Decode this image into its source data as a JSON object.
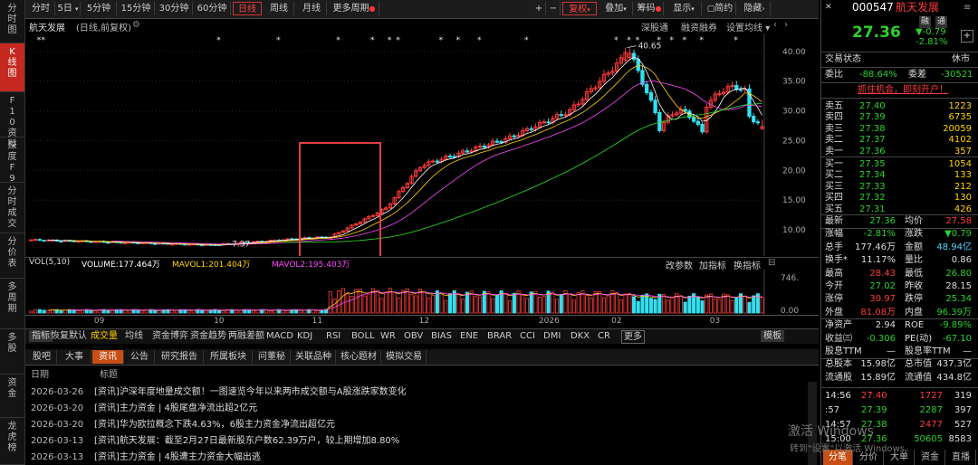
{
  "sidebar": [
    {
      "label": "分时图",
      "active": false
    },
    {
      "label": "K线图",
      "active": true
    },
    {
      "label": "F10资料",
      "active": false
    },
    {
      "label": "深度F9",
      "active": false
    },
    {
      "label": "分时成交",
      "active": false
    },
    {
      "label": "分价表",
      "active": false
    },
    {
      "label": "多周期",
      "active": false
    },
    {
      "label": "多股",
      "active": false
    },
    {
      "label": "资金",
      "active": false
    },
    {
      "label": "龙虎榜",
      "active": false
    }
  ],
  "toolbar": {
    "periods": [
      "分时",
      "5日",
      "5分钟",
      "15分钟",
      "30分钟",
      "60分钟",
      "日线",
      "周线",
      "月线",
      "更多周期"
    ],
    "active_period": "日线",
    "right_buttons": [
      "+",
      "−",
      "复权",
      "叠加",
      "筹码",
      "显示",
      "简约",
      "隐藏"
    ],
    "active_right": "复权"
  },
  "title_row": {
    "stock_name": "航天发展",
    "mode": "(日线,前复权)",
    "links": [
      "深股通",
      "融资融券",
      "设置均线"
    ]
  },
  "chart_data": [
    {
      "type": "candlestick",
      "name": "航天发展",
      "y_ticks": [
        10.0,
        15.0,
        20.0,
        25.0,
        30.0,
        35.0,
        40.0
      ],
      "ylim": [
        6.5,
        41.5
      ],
      "annotations": [
        {
          "label": "7.37",
          "x_index": 44,
          "value": 7.37
        },
        {
          "label": "40.65",
          "x_index": 139,
          "value": 40.65
        }
      ],
      "x_ticks": [
        {
          "label": "09",
          "x_index": 16
        },
        {
          "label": "10",
          "x_index": 44
        },
        {
          "label": "11",
          "x_index": 67
        },
        {
          "label": "12",
          "x_index": 92
        },
        {
          "label": "2026",
          "x_index": 120
        },
        {
          "label": "02",
          "x_index": 137
        },
        {
          "label": "03",
          "x_index": 160
        }
      ]
    },
    {
      "type": "bar",
      "name": "VOL(5,10)",
      "ylim": [
        0,
        746
      ],
      "y_ticks": [
        0,
        746
      ],
      "y_tick_labels": [
        "0.00",
        "746."
      ],
      "legend": [
        {
          "name": "VOLUME",
          "value": "177.464万",
          "color": "#ffffff"
        },
        {
          "name": "MAVOL1",
          "value": "201.404万",
          "color": "#ffd400"
        },
        {
          "name": "MAVOL2",
          "value": "195.403万",
          "color": "#ff48ff"
        }
      ]
    }
  ],
  "vol_header": {
    "label": "VOL(5,10)",
    "vol": "VOLUME:177.464万",
    "mavol1": "MAVOL1:201.404万",
    "mavol2": "MAVOL2:195.403万",
    "right": [
      "改参数",
      "加指标",
      "换指标"
    ]
  },
  "indicators": {
    "items": [
      "指标",
      "恢复默认",
      "成交量",
      "均线",
      "资金博弈",
      "资金趋势",
      "两融差额",
      "MACD",
      "KDJ",
      "RSI",
      "BOLL",
      "WR",
      "OBV",
      "BIAS",
      "ENE",
      "BRAR",
      "CCI",
      "DMI",
      "DKX",
      "CR",
      "更多",
      "模板"
    ],
    "active": "成交量"
  },
  "news": {
    "tabs": [
      "股吧",
      "大事",
      "资讯",
      "公告",
      "研究报告",
      "所属板块",
      "问董秘",
      "关联品种",
      "核心题材",
      "模拟交易"
    ],
    "active": "资讯",
    "head_date": "日期",
    "head_title": "标题",
    "rows": [
      {
        "date": "2026-03-26",
        "tag": "[资讯]",
        "title": "沪深年度地量成交额！一图速览今年以来两市成交额与A股涨跌家数变化"
      },
      {
        "date": "2026-03-20",
        "tag": "[资讯]",
        "title": "主力资金 | 4股尾盘净流出超2亿元"
      },
      {
        "date": "2026-03-20",
        "tag": "[资讯]",
        "title": "华为欧拉概念下跌4.63%，6股主力资金净流出超亿元"
      },
      {
        "date": "2026-03-13",
        "tag": "[资讯]",
        "title": "航天发展：截至2月27日最新股东户数62.39万户，较上期增加8.80%"
      },
      {
        "date": "2026-03-13",
        "tag": "[资讯]",
        "title": "主力资金 | 4股遭主力资金大幅出逃"
      }
    ]
  },
  "quote": {
    "code": "000547",
    "name": "航天发展",
    "badges": [
      "融",
      "通"
    ],
    "price": "27.36",
    "change": "-0.79",
    "change_pct": "-2.81%",
    "status_label": "交易状态",
    "status": "休市",
    "webi_label": "委比",
    "webi": "-88.64%",
    "weicha_label": "委差",
    "weicha": "-30521",
    "banner": "抓住机会，即刻开户！",
    "asks": [
      {
        "label": "卖五",
        "price": "27.40",
        "vol": "1223"
      },
      {
        "label": "卖四",
        "price": "27.39",
        "vol": "6735"
      },
      {
        "label": "卖三",
        "price": "27.38",
        "vol": "20059"
      },
      {
        "label": "卖二",
        "price": "27.37",
        "vol": "4102"
      },
      {
        "label": "卖一",
        "price": "27.36",
        "vol": "357"
      }
    ],
    "bids": [
      {
        "label": "买一",
        "price": "27.35",
        "vol": "1054"
      },
      {
        "label": "买二",
        "price": "27.34",
        "vol": "133"
      },
      {
        "label": "买三",
        "price": "27.33",
        "vol": "212"
      },
      {
        "label": "买四",
        "price": "27.32",
        "vol": "130"
      },
      {
        "label": "买五",
        "price": "27.31",
        "vol": "426"
      }
    ],
    "stats": [
      [
        "最新",
        "27.36",
        "均价",
        "27.58"
      ],
      [
        "涨幅",
        "-2.81%",
        "涨跌",
        "▼0.79"
      ],
      [
        "总手",
        "177.46万",
        "金额",
        "48.94亿"
      ],
      [
        "换手*",
        "11.17%",
        "量比",
        "0.86"
      ],
      [
        "最高",
        "28.43",
        "最低",
        "26.80"
      ],
      [
        "今开",
        "27.02",
        "昨收",
        "28.15"
      ],
      [
        "涨停",
        "30.97",
        "跌停",
        "25.34"
      ],
      [
        "外盘",
        "81.08万",
        "内盘",
        "96.39万"
      ],
      [
        "净资产",
        "2.94",
        "ROE",
        "-9.89%"
      ],
      [
        "收益㈢",
        "-0.306",
        "PE(动)",
        "-67.10"
      ],
      [
        "股息TTM",
        "—",
        "股息率TTM",
        "—"
      ],
      [
        "总股本",
        "15.98亿",
        "总市值",
        "437.3亿"
      ],
      [
        "流通股",
        "15.89亿",
        "流通值",
        "434.8亿"
      ]
    ],
    "ticks": [
      {
        "time": "14:56",
        "price": "27.40",
        "vol": "1727",
        "n": "319"
      },
      {
        "time": ":57",
        "price": "27.39",
        "vol": "2287",
        "n": "397"
      },
      {
        "time": "14:57",
        "price": "27.38",
        "vol": "2477",
        "n": "527"
      },
      {
        "time": "15:00",
        "price": "27.36",
        "vol": "50605",
        "n": "8583"
      }
    ],
    "bottom_tabs": [
      "分笔",
      "分价",
      "大单",
      "资金",
      "直播"
    ],
    "bottom_active": "分笔"
  },
  "watermark": {
    "line1": "激活 Windows",
    "line2": "转到\"设置\"以激活 Windows。"
  }
}
